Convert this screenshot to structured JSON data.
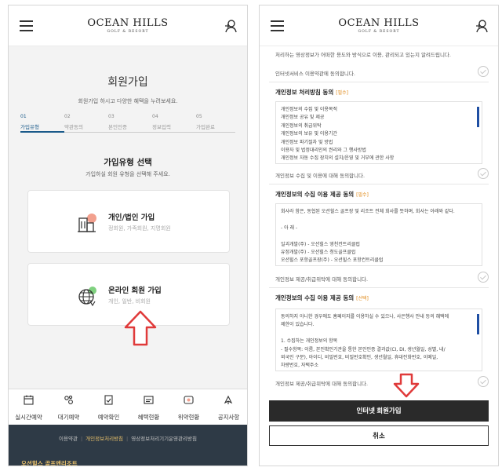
{
  "header": {
    "brand": "OCEAN HILLS",
    "brand_sub": "GOLF & RESORT"
  },
  "left": {
    "title": "회원가입",
    "desc": "회원가입 하시고 다양한 혜택을 누려보세요.",
    "steps": [
      {
        "num": "01",
        "label": "가입유형"
      },
      {
        "num": "02",
        "label": "약관동의"
      },
      {
        "num": "03",
        "label": "본인인증"
      },
      {
        "num": "04",
        "label": "정보입력"
      },
      {
        "num": "05",
        "label": "가입완료"
      }
    ],
    "section_title": "가입유형 선택",
    "section_desc": "가입하실 회원 유형을 선택해 주세요.",
    "cards": [
      {
        "title": "개인/법인 가입",
        "sub": "정회원, 가족회원, 지명회원",
        "icon": "building-icon"
      },
      {
        "title": "온라인 회원 가입",
        "sub": "개인, 일반, 비회원",
        "icon": "globe-icon"
      }
    ],
    "nav": [
      {
        "label": "실시간예약",
        "icon": "calendar-icon"
      },
      {
        "label": "대기예약",
        "icon": "waitlist-icon"
      },
      {
        "label": "예약확인",
        "icon": "check-doc-icon"
      },
      {
        "label": "혜택현황",
        "icon": "benefit-icon"
      },
      {
        "label": "위약현황",
        "icon": "penalty-icon"
      },
      {
        "label": "공지사항",
        "icon": "notice-icon"
      }
    ],
    "footer": {
      "links": [
        "이용약관",
        "개인정보처리방침",
        "영상정보처리기기운영관리방침"
      ],
      "brand": "오션힐스 골프앤리조트"
    }
  },
  "right": {
    "top_text": "처리하는 영상정보가 어떠한 용도와 방식으로 이용, 관리되고 있는지 알려드립니다.",
    "agree_service": "인터넷서비스 이용약관에 동의합니다.",
    "section1": {
      "title": "개인정보 처리방침 동의",
      "badge": "[필수]",
      "lines": [
        "개인정보의 수집 및 이용목적",
        "개인정보 공유 및 제공",
        "개인정보의 취급위탁",
        "개인정보의 보유 및 이용기간",
        "개인정보 파기절차 및 방법",
        "이용자 및 법정대리인의 권리와 그 행사방법",
        "개인정보 자동 수집 장치의 설치/운영 및 거부에 관한 사항"
      ],
      "agree": "개인정보 수집 및 이용에 대해 동의합니다."
    },
    "section2": {
      "title": "개인정보의 수집 이용 제공 동의",
      "badge": "[필수]",
      "lines": [
        "회사라 함은, 동협된 오션힐스 골프장 및 리조트 전체 회사를 뜻하며, 회사는 아래와 같다.",
        "",
        "- 아 래 -",
        "",
        "일괴개발(주) - 오션힐스 영천컨트리클럽",
        "유정개발(주) - 오션힐스 청도골프클럽",
        "오션힐스 포항골프장(주) - 오션힐스 포항컨트리클럽"
      ],
      "agree": "개인정보 제공/취급위탁에 대해 동의합니다."
    },
    "section3": {
      "title": "개인정보의 수집 이용 제공 동의",
      "badge": "[선택]",
      "lines": [
        "동의하지 아니한 경우에도 홈페이지를 이용하실 수 있으나, 사은행사 안내 등의 혜택에",
        "제한이 있습니다.",
        "",
        "1. 수집하는 개인정보의 항목",
        "- 필수항목: 이름, 본인확인기관을 통한 본인인증 결과값(CI, DI, 생년월일, 성별, 내/",
        "외국인 구분), 아이디, 비밀번호, 비밀번호확인, 생년월일, 휴대전화번호, 이메일,",
        "차량번호, 자택주소"
      ],
      "agree": "개인정보 제공/취급위탁에 대해 동의합니다."
    },
    "submit": "인터넷 회원가입",
    "cancel": "취소"
  },
  "colors": {
    "accent_blue": "#1a5a8a",
    "footer_bg": "#2e3a46",
    "footer_highlight": "#e8c06a",
    "arrow_red": "#e03a3a",
    "badge_orange": "#e08a1a"
  }
}
